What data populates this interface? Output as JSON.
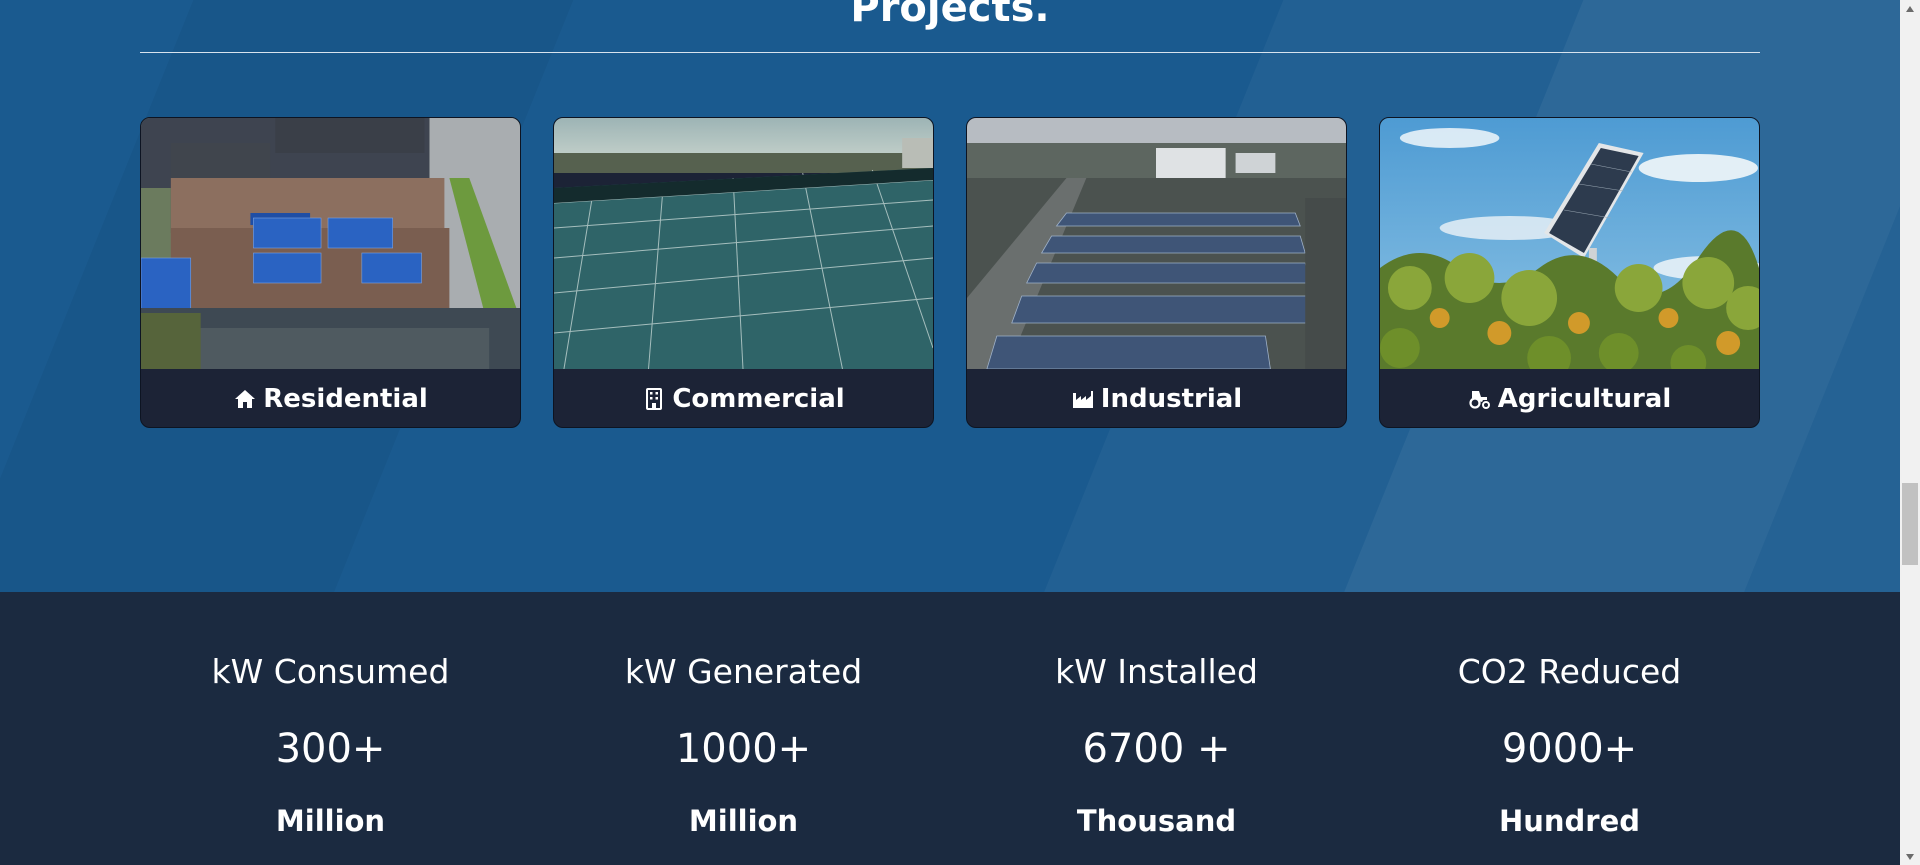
{
  "projects": {
    "title": "Projects.",
    "cards": [
      {
        "label": "Residential",
        "icon": "home-icon"
      },
      {
        "label": "Commercial",
        "icon": "building-icon"
      },
      {
        "label": "Industrial",
        "icon": "industry-icon"
      },
      {
        "label": "Agricultural",
        "icon": "tractor-icon"
      }
    ]
  },
  "stats": [
    {
      "label": "kW Consumed",
      "value": "300+",
      "unit": "Million"
    },
    {
      "label": "kW Generated",
      "value": "1000+",
      "unit": "Million"
    },
    {
      "label": "kW Installed",
      "value": "6700 +",
      "unit": "Thousand"
    },
    {
      "label": "CO2 Reduced",
      "value": "9000+",
      "unit": "Hundred"
    }
  ],
  "colors": {
    "projects_bg": "#1a5a8f",
    "stats_bg": "#1b2a40",
    "card_bg": "#1c2336",
    "text": "#ffffff"
  }
}
